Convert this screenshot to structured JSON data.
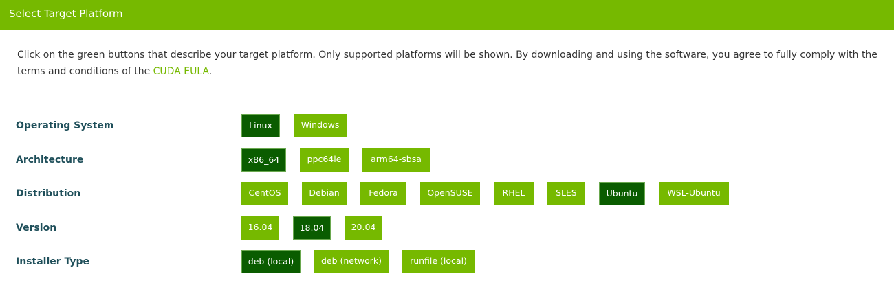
{
  "header": {
    "title": "Select Target Platform"
  },
  "intro": {
    "text_before": "Click on the green buttons that describe your target platform. Only supported platforms will be shown. By downloading and using the software, you agree to fully comply with the terms and conditions of the ",
    "link_text": "CUDA EULA",
    "text_after": "."
  },
  "rows": {
    "os": {
      "label": "Operating System",
      "options": [
        "Linux",
        "Windows"
      ],
      "selected": "Linux"
    },
    "arch": {
      "label": "Architecture",
      "options": [
        "x86_64",
        "ppc64le",
        "arm64-sbsa"
      ],
      "selected": "x86_64"
    },
    "distro": {
      "label": "Distribution",
      "options": [
        "CentOS",
        "Debian",
        "Fedora",
        "OpenSUSE",
        "RHEL",
        "SLES",
        "Ubuntu",
        "WSL-Ubuntu"
      ],
      "selected": "Ubuntu"
    },
    "version": {
      "label": "Version",
      "options": [
        "16.04",
        "18.04",
        "20.04"
      ],
      "selected": "18.04"
    },
    "installer": {
      "label": "Installer Type",
      "options": [
        "deb (local)",
        "deb (network)",
        "runfile (local)"
      ],
      "selected": "deb (local)"
    }
  },
  "colors": {
    "brand_green": "#76b900",
    "selected_green": "#0a5c00",
    "label_color": "#1f4f5a"
  }
}
